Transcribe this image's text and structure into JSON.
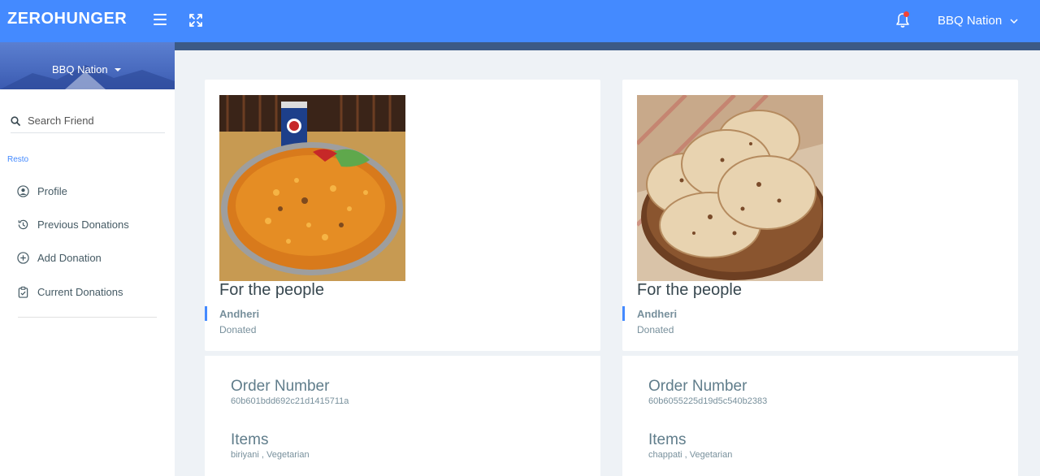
{
  "header": {
    "brand": "ZEROHUNGER",
    "user_name": "BBQ Nation"
  },
  "sidebar": {
    "profile_name": "BBQ Nation",
    "search_placeholder": "Search Friend",
    "section_title": "Resto",
    "items": [
      {
        "label": "Profile",
        "icon": "user-circle-icon"
      },
      {
        "label": "Previous Donations",
        "icon": "history-icon"
      },
      {
        "label": "Add Donation",
        "icon": "plus-circle-icon"
      },
      {
        "label": "Current Donations",
        "icon": "clipboard-check-icon"
      }
    ]
  },
  "donations": [
    {
      "title": "For the people",
      "location": "Andheri",
      "status": "Donated",
      "order_label": "Order Number",
      "order_number": "60b601bdd692c21d1415711a",
      "items_label": "Items",
      "items": "biriyani , Vegetarian"
    },
    {
      "title": "For the people",
      "location": "Andheri",
      "status": "Donated",
      "order_label": "Order Number",
      "order_number": "60b6055225d19d5c540b2383",
      "items_label": "Items",
      "items": "chappati , Vegetarian"
    }
  ],
  "colors": {
    "primary": "#448aff",
    "sidebar_bg": "#ffffff",
    "page_bg": "#eef2f6"
  }
}
